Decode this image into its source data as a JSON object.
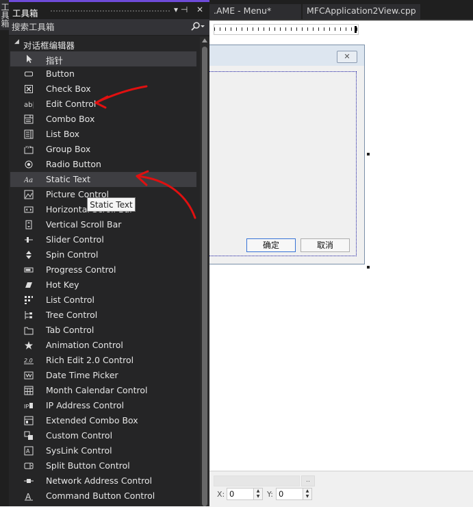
{
  "left_strip": {
    "tab_label": "工具箱"
  },
  "toolbox": {
    "title": "工具箱",
    "pin_label": "▾ ⊣",
    "close_label": "✕",
    "search": {
      "placeholder": "搜索工具箱",
      "icon": "search-icon"
    },
    "group": {
      "label": "对话框编辑器"
    },
    "items": [
      {
        "label": "指针",
        "icon": "pointer-icon",
        "selected": true
      },
      {
        "label": "Button",
        "icon": "button-icon"
      },
      {
        "label": "Check Box",
        "icon": "checkbox-icon"
      },
      {
        "label": "Edit Control",
        "icon": "edit-control-icon"
      },
      {
        "label": "Combo Box",
        "icon": "combo-box-icon"
      },
      {
        "label": "List Box",
        "icon": "list-box-icon"
      },
      {
        "label": "Group Box",
        "icon": "group-box-icon"
      },
      {
        "label": "Radio Button",
        "icon": "radio-button-icon"
      },
      {
        "label": "Static Text",
        "icon": "static-text-icon",
        "selected": true
      },
      {
        "label": "Picture Control",
        "icon": "picture-control-icon"
      },
      {
        "label": "Horizontal Scroll Bar",
        "icon": "hscroll-icon"
      },
      {
        "label": "Vertical Scroll Bar",
        "icon": "vscroll-icon"
      },
      {
        "label": "Slider Control",
        "icon": "slider-icon"
      },
      {
        "label": "Spin Control",
        "icon": "spin-icon"
      },
      {
        "label": "Progress Control",
        "icon": "progress-icon"
      },
      {
        "label": "Hot Key",
        "icon": "hotkey-icon"
      },
      {
        "label": "List Control",
        "icon": "list-control-icon"
      },
      {
        "label": "Tree Control",
        "icon": "tree-control-icon"
      },
      {
        "label": "Tab Control",
        "icon": "tab-control-icon"
      },
      {
        "label": "Animation Control",
        "icon": "animation-icon"
      },
      {
        "label": "Rich Edit 2.0 Control",
        "icon": "rich-edit-icon"
      },
      {
        "label": "Date Time Picker",
        "icon": "date-time-icon"
      },
      {
        "label": "Month Calendar Control",
        "icon": "calendar-icon"
      },
      {
        "label": "IP Address Control",
        "icon": "ip-address-icon"
      },
      {
        "label": "Extended Combo Box",
        "icon": "ext-combo-icon"
      },
      {
        "label": "Custom Control",
        "icon": "custom-control-icon"
      },
      {
        "label": "SysLink Control",
        "icon": "syslink-icon"
      },
      {
        "label": "Split Button Control",
        "icon": "split-button-icon"
      },
      {
        "label": "Network Address Control",
        "icon": "network-address-icon"
      },
      {
        "label": "Command Button Control",
        "icon": "command-button-icon"
      }
    ]
  },
  "tooltip": {
    "text": "Static Text"
  },
  "tabs": [
    {
      "label": ".AME - Menu*"
    },
    {
      "label": "MFCApplication2View.cpp"
    }
  ],
  "dialog": {
    "close_label": "✕",
    "ok_label": "确定",
    "cancel_label": "取消"
  },
  "bottom": {
    "dots_label": "..",
    "x_label": "X:",
    "x_value": "0",
    "y_label": "Y:",
    "y_value": "0"
  },
  "colors": {
    "accent": "#6e4bd8",
    "annotation": "#e01010"
  }
}
